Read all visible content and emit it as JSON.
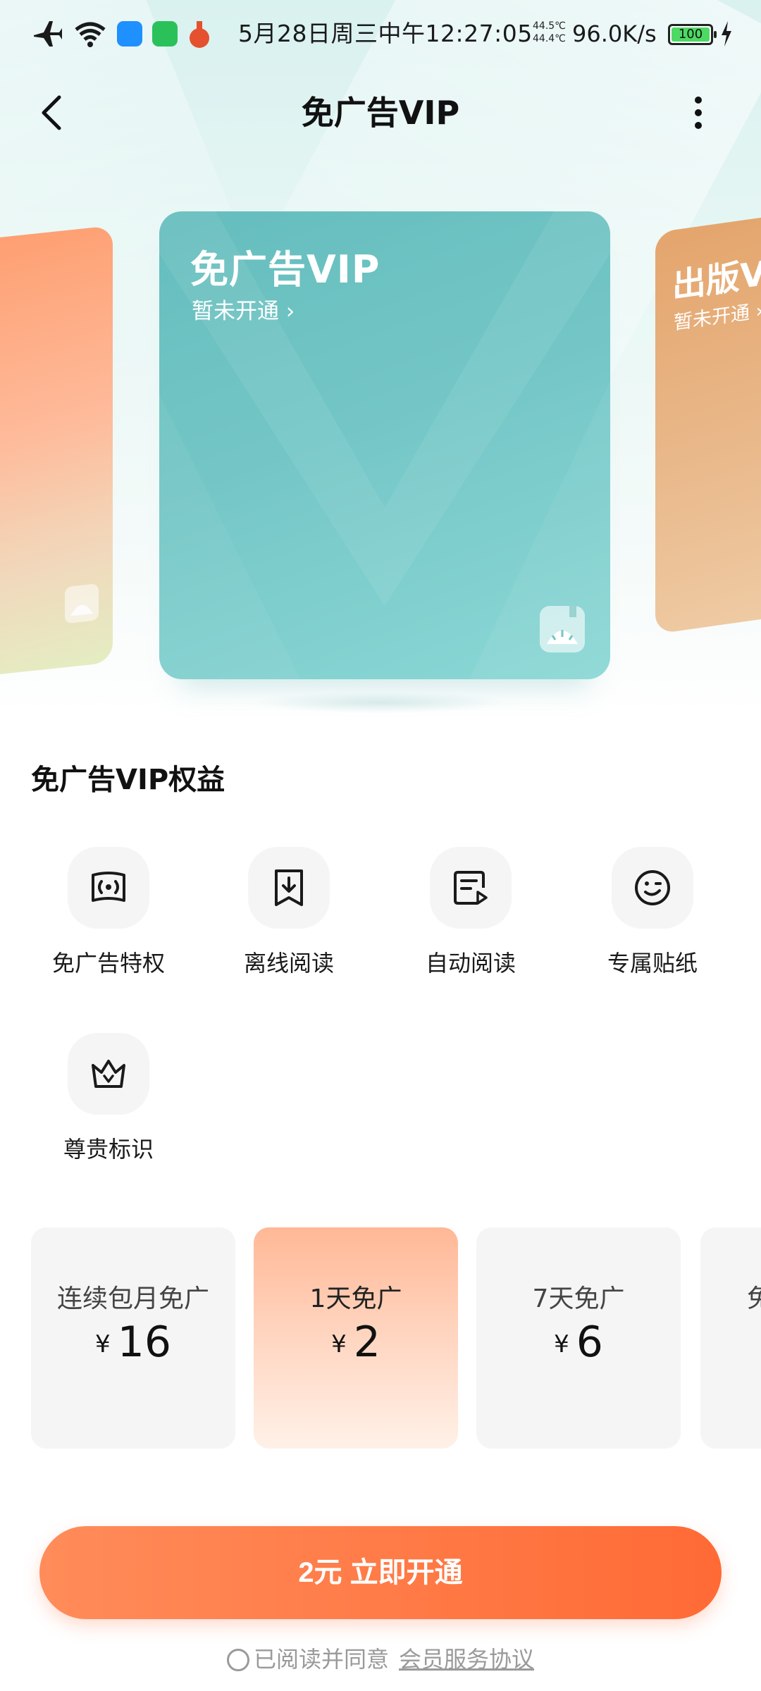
{
  "status_bar": {
    "time": "5月28日周三中午12:27:05",
    "temp_top": "44.5℃",
    "temp_bottom": "44.4℃",
    "net_speed": "96.0K/s",
    "battery": "100",
    "icons": [
      "airplane-icon",
      "wifi-icon",
      "qq-icon",
      "wechat-icon",
      "app-icon"
    ]
  },
  "header": {
    "title": "免广告VIP"
  },
  "carousel": {
    "main_card": {
      "title": "免广告VIP",
      "status": "暂未开通 ›"
    },
    "right_card": {
      "title": "出版V",
      "status": "暂未开通 ›"
    }
  },
  "benefits": {
    "title": "免广告VIP权益",
    "items": [
      {
        "label": "免广告特权",
        "icon": "ad-free-icon"
      },
      {
        "label": "离线阅读",
        "icon": "download-icon"
      },
      {
        "label": "自动阅读",
        "icon": "auto-read-icon"
      },
      {
        "label": "专属贴纸",
        "icon": "sticker-icon"
      },
      {
        "label": "尊贵标识",
        "icon": "crown-icon"
      }
    ]
  },
  "plans": [
    {
      "name": "连续包月免广",
      "currency": "¥",
      "price": "16"
    },
    {
      "name": "1天免广",
      "currency": "¥",
      "price": "2",
      "selected": true
    },
    {
      "name": "7天免广",
      "currency": "¥",
      "price": "6"
    },
    {
      "name": "免"
    }
  ],
  "cta": {
    "label": "2元 立即开通"
  },
  "agreement": {
    "text": "已阅读并同意",
    "link": "会员服务协议"
  },
  "colors": {
    "accent": "#ff7a46",
    "card_teal": "#74c6c6",
    "selected_plan": "#ffb896"
  }
}
